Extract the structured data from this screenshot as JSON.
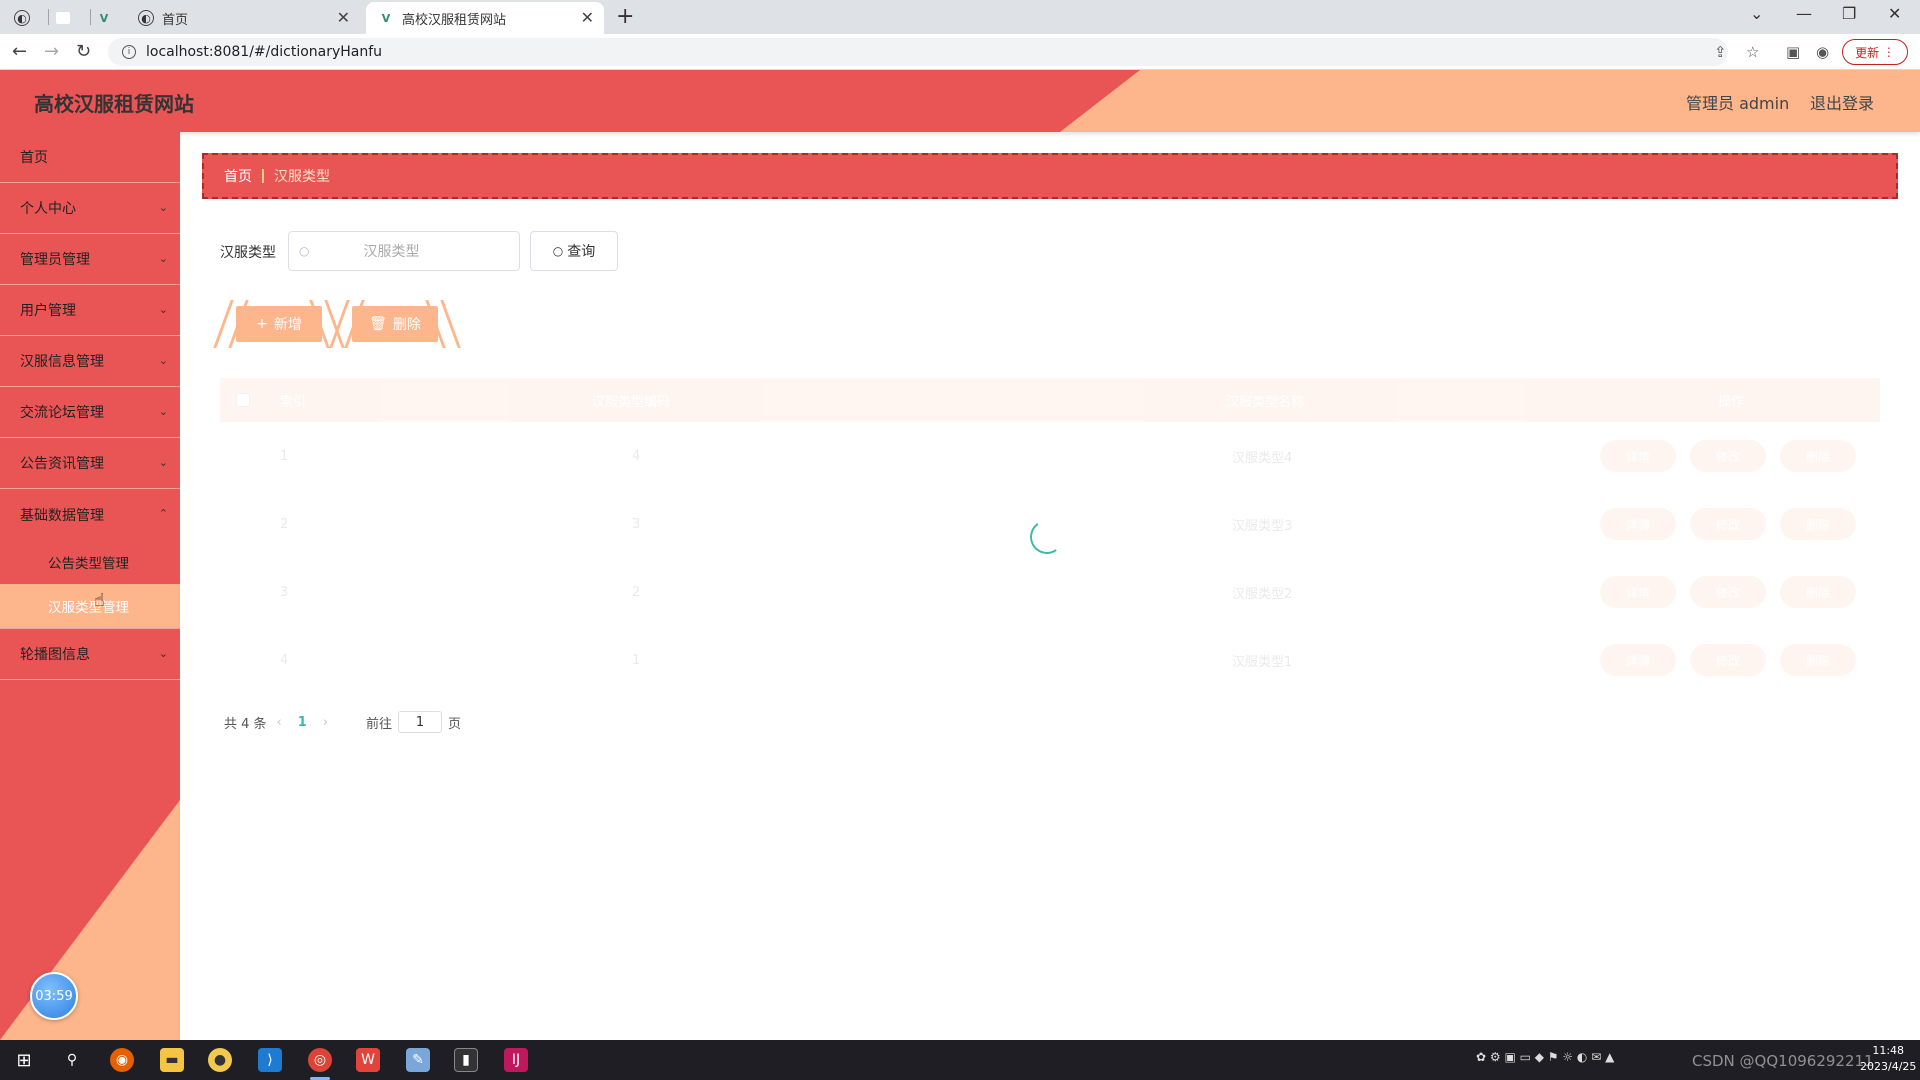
{
  "browser": {
    "tabs": [
      {
        "label": "首页"
      },
      {
        "label": "高校汉服租赁网站"
      }
    ],
    "url": "localhost:8081/#/dictionaryHanfu",
    "update_label": "更新"
  },
  "header": {
    "site_title": "高校汉服租赁网站",
    "user_label": "管理员 admin",
    "logout_label": "退出登录"
  },
  "sidebar": {
    "items": [
      {
        "label": "首页"
      },
      {
        "label": "个人中心"
      },
      {
        "label": "管理员管理"
      },
      {
        "label": "用户管理"
      },
      {
        "label": "汉服信息管理"
      },
      {
        "label": "交流论坛管理"
      },
      {
        "label": "公告资讯管理"
      },
      {
        "label": "基础数据管理"
      },
      {
        "label": "轮播图信息"
      }
    ],
    "submenu": [
      {
        "label": "公告类型管理"
      },
      {
        "label": "汉服类型管理"
      }
    ],
    "timer": "03:59"
  },
  "breadcrumb": {
    "home": "首页",
    "current": "汉服类型"
  },
  "search": {
    "label": "汉服类型",
    "placeholder": "汉服类型",
    "query_label": "查询"
  },
  "actions": {
    "add_label": "新增",
    "delete_label": "删除"
  },
  "table": {
    "columns": [
      "索引",
      "汉服类型编码",
      "汉服类型名称",
      "操作"
    ],
    "rows": [
      {
        "index": "1",
        "code": "4",
        "name": "汉服类型4"
      },
      {
        "index": "2",
        "code": "3",
        "name": "汉服类型3"
      },
      {
        "index": "3",
        "code": "2",
        "name": "汉服类型2"
      },
      {
        "index": "4",
        "code": "1",
        "name": "汉服类型1"
      }
    ],
    "row_actions": [
      "详情",
      "修改",
      "删除"
    ],
    "loading": true
  },
  "pagination": {
    "total": "共 4 条",
    "current_page": "1",
    "goto_label": "前往",
    "goto_value": "1",
    "page_suffix": "页"
  },
  "taskbar": {
    "time": "11:48",
    "date": "2023/4/25",
    "watermark": "CSDN @QQ1096292211"
  },
  "colors": {
    "primary_red": "#e95555",
    "accent_peach": "#fdb68b",
    "spinner": "#3bb9b0"
  }
}
